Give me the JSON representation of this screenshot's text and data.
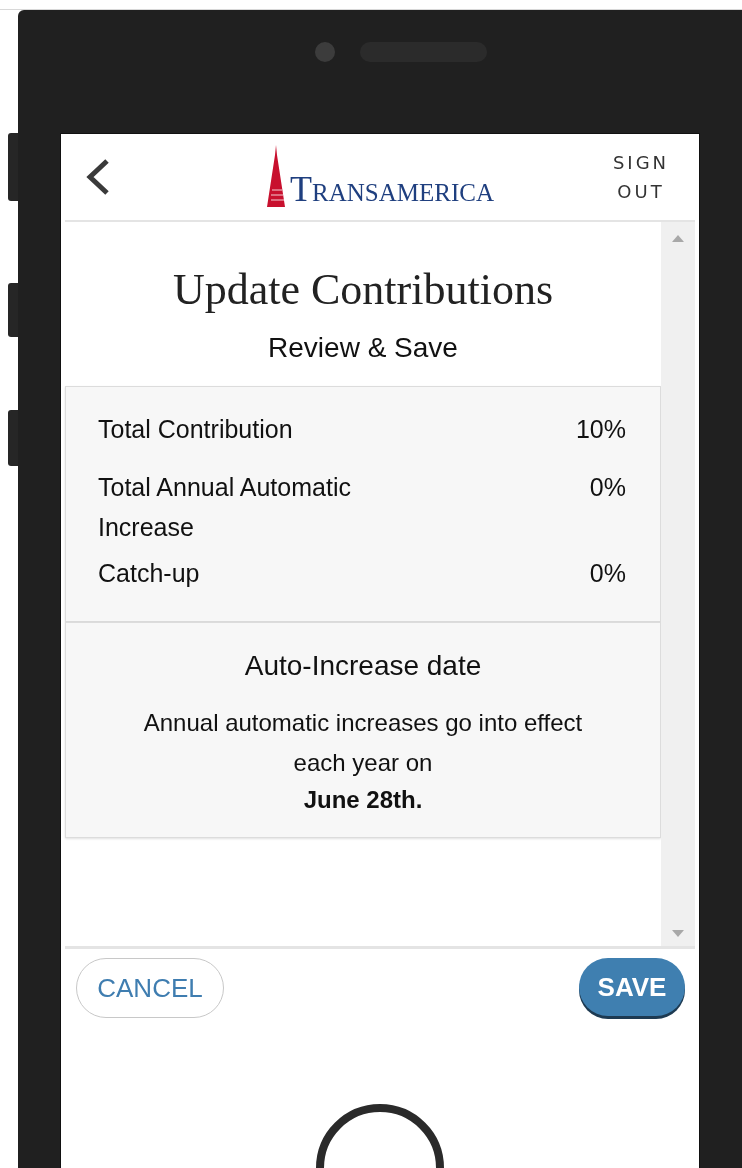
{
  "header": {
    "logo": "TRANSAMERICA",
    "sign_out": "SIGN OUT"
  },
  "title": "Update Contributions",
  "subtitle": "Review & Save",
  "summary": [
    {
      "label": "Total Contribution",
      "value": "10%"
    },
    {
      "label": "Total Annual Automatic Increase",
      "value": "0%"
    },
    {
      "label": "Catch-up",
      "value": "0%"
    }
  ],
  "auto_increase": {
    "heading": "Auto-Increase date",
    "text": "Annual automatic increases go into effect each year on",
    "date": "June 28th."
  },
  "buttons": [
    {
      "label": "CANCEL",
      "kind": "secondary"
    },
    {
      "label": "SAVE",
      "kind": "primary"
    }
  ]
}
